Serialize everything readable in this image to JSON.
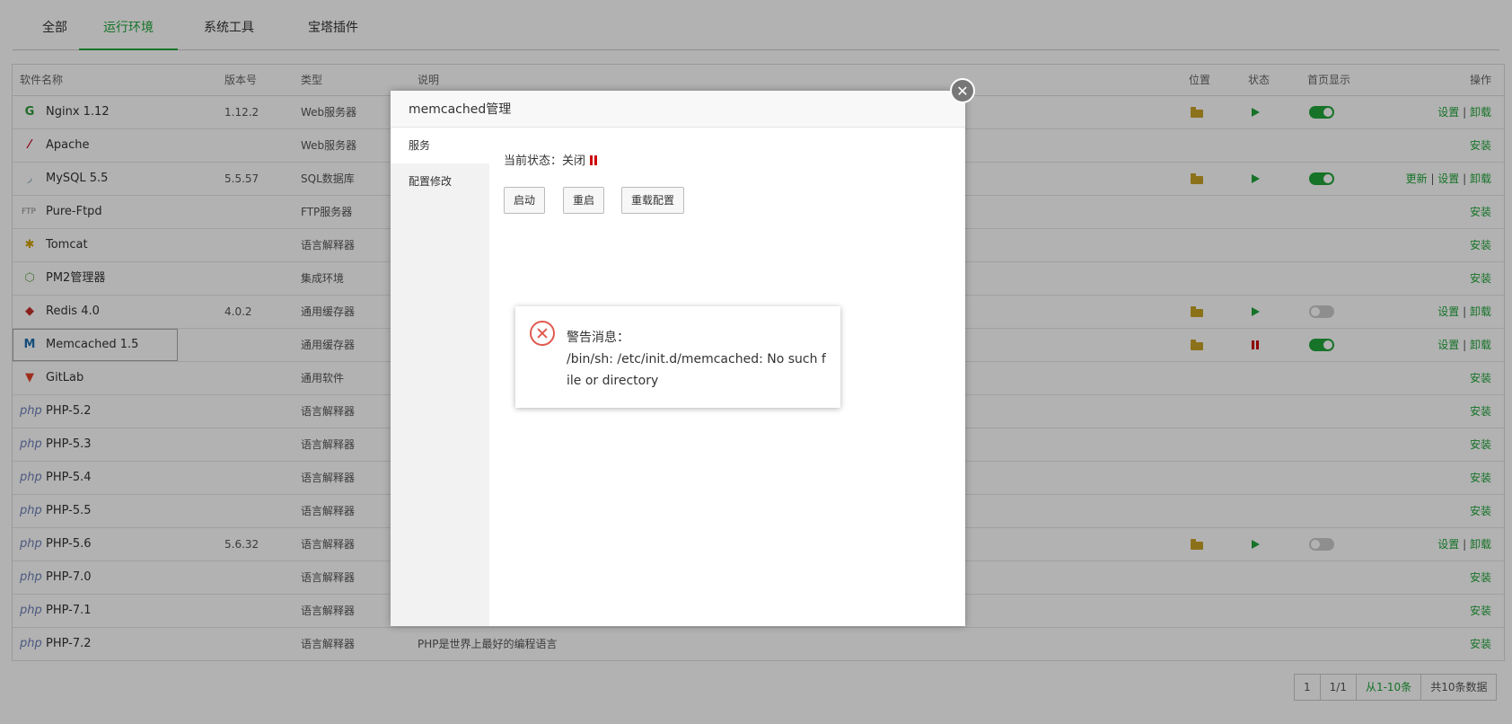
{
  "tabs": [
    "全部",
    "运行环境",
    "系统工具",
    "宝塔插件"
  ],
  "table": {
    "headers": {
      "name": "软件名称",
      "version": "版本号",
      "type": "类型",
      "desc": "说明",
      "location": "位置",
      "status": "状态",
      "home": "首页显示",
      "ops": "操作"
    },
    "rows": [
      {
        "icon": "nginx-icon",
        "glyph": "G",
        "color": "#2e9b3a",
        "name": "Nginx 1.12",
        "version": "1.12.2",
        "type": "Web服务器",
        "desc": "",
        "folder": true,
        "status": "running",
        "toggle": "on",
        "ops": [
          "设置",
          "卸载"
        ]
      },
      {
        "icon": "apache-icon",
        "glyph": "⁄",
        "color": "#c8102e",
        "name": "Apache",
        "version": "",
        "type": "Web服务器",
        "desc": "",
        "folder": false,
        "status": "",
        "toggle": "",
        "ops": [
          "安装"
        ]
      },
      {
        "icon": "mysql-icon",
        "glyph": "◞",
        "color": "#5d87a1",
        "name": "MySQL 5.5",
        "version": "5.5.57",
        "type": "SQL数据库",
        "desc": "",
        "folder": true,
        "status": "running",
        "toggle": "on",
        "ops": [
          "更新",
          "设置",
          "卸载"
        ]
      },
      {
        "icon": "ftp-icon",
        "glyph": "FTP",
        "color": "#888",
        "name": "Pure-Ftpd",
        "version": "",
        "type": "FTP服务器",
        "desc": "",
        "folder": false,
        "status": "",
        "toggle": "",
        "ops": [
          "安装"
        ]
      },
      {
        "icon": "tomcat-icon",
        "glyph": "✱",
        "color": "#d1a000",
        "name": "Tomcat",
        "version": "",
        "type": "语言解释器",
        "desc": "",
        "folder": false,
        "status": "",
        "toggle": "",
        "ops": [
          "安装"
        ]
      },
      {
        "icon": "nodejs-icon",
        "glyph": "⬡",
        "color": "#6aa84f",
        "name": "PM2管理器",
        "version": "",
        "type": "集成环境",
        "desc": "",
        "folder": false,
        "status": "",
        "toggle": "",
        "ops": [
          "安装"
        ]
      },
      {
        "icon": "redis-icon",
        "glyph": "◆",
        "color": "#c6302b",
        "name": "Redis 4.0",
        "version": "4.0.2",
        "type": "通用缓存器",
        "desc": "",
        "folder": true,
        "status": "running",
        "toggle": "off",
        "ops": [
          "设置",
          "卸载"
        ]
      },
      {
        "icon": "memcached-icon",
        "glyph": "M",
        "color": "#1f6fb2",
        "name": "Memcached 1.5",
        "version": "",
        "type": "通用缓存器",
        "desc": "",
        "folder": true,
        "status": "stopped",
        "toggle": "on",
        "ops": [
          "设置",
          "卸载"
        ]
      },
      {
        "icon": "gitlab-icon",
        "glyph": "▼",
        "color": "#e24329",
        "name": "GitLab",
        "version": "",
        "type": "通用软件",
        "desc": "",
        "folder": false,
        "status": "",
        "toggle": "",
        "ops": [
          "安装"
        ]
      },
      {
        "icon": "php-icon",
        "glyph": "php",
        "color": "#6c7eb7",
        "name": "PHP-5.2",
        "version": "",
        "type": "语言解释器",
        "desc": "",
        "folder": false,
        "status": "",
        "toggle": "",
        "ops": [
          "安装"
        ]
      },
      {
        "icon": "php-icon",
        "glyph": "php",
        "color": "#6c7eb7",
        "name": "PHP-5.3",
        "version": "",
        "type": "语言解释器",
        "desc": "",
        "folder": false,
        "status": "",
        "toggle": "",
        "ops": [
          "安装"
        ]
      },
      {
        "icon": "php-icon",
        "glyph": "php",
        "color": "#6c7eb7",
        "name": "PHP-5.4",
        "version": "",
        "type": "语言解释器",
        "desc": "",
        "folder": false,
        "status": "",
        "toggle": "",
        "ops": [
          "安装"
        ]
      },
      {
        "icon": "php-icon",
        "glyph": "php",
        "color": "#6c7eb7",
        "name": "PHP-5.5",
        "version": "",
        "type": "语言解释器",
        "desc": "",
        "folder": false,
        "status": "",
        "toggle": "",
        "ops": [
          "安装"
        ]
      },
      {
        "icon": "php-icon",
        "glyph": "php",
        "color": "#6c7eb7",
        "name": "PHP-5.6",
        "version": "5.6.32",
        "type": "语言解释器",
        "desc": "",
        "folder": true,
        "status": "running",
        "toggle": "off",
        "ops": [
          "设置",
          "卸载"
        ]
      },
      {
        "icon": "php-icon",
        "glyph": "php",
        "color": "#6c7eb7",
        "name": "PHP-7.0",
        "version": "",
        "type": "语言解释器",
        "desc": "",
        "folder": false,
        "status": "",
        "toggle": "",
        "ops": [
          "安装"
        ]
      },
      {
        "icon": "php-icon",
        "glyph": "php",
        "color": "#6c7eb7",
        "name": "PHP-7.1",
        "version": "",
        "type": "语言解释器",
        "desc": "",
        "folder": false,
        "status": "",
        "toggle": "",
        "ops": [
          "安装"
        ]
      },
      {
        "icon": "php-icon",
        "glyph": "php",
        "color": "#6c7eb7",
        "name": "PHP-7.2",
        "version": "",
        "type": "语言解释器",
        "desc": "PHP是世界上最好的编程语言",
        "folder": false,
        "status": "",
        "toggle": "",
        "ops": [
          "安装"
        ]
      }
    ]
  },
  "pager": {
    "page": "1",
    "total_pages": "1/1",
    "range": "从1-10条",
    "total": "共10条数据"
  },
  "modal": {
    "title": "memcached管理",
    "close": "✕",
    "side": [
      "服务",
      "配置修改"
    ],
    "status_label": "当前状态：关闭",
    "buttons": [
      "启动",
      "重启",
      "重载配置"
    ]
  },
  "alert": {
    "title": "警告消息：",
    "message": "/bin/sh: /etc/init.d/memcached: No such file or directory"
  },
  "colors": {
    "accent": "#20a53a",
    "danger": "#c00",
    "error_icon": "#e05a4f"
  }
}
